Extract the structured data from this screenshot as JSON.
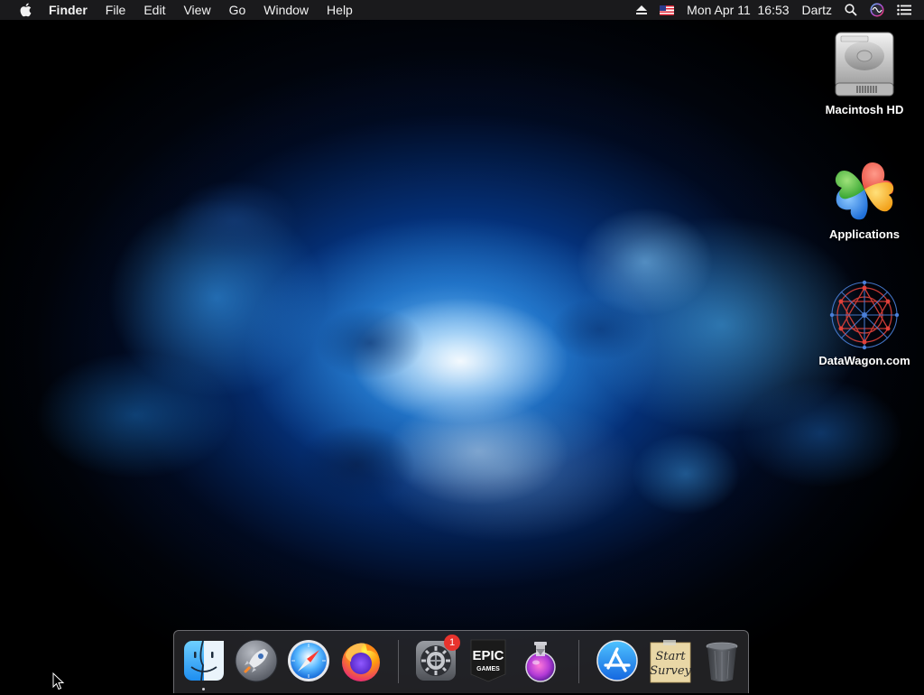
{
  "menubar": {
    "app_name": "Finder",
    "menus": [
      "File",
      "Edit",
      "View",
      "Go",
      "Window",
      "Help"
    ],
    "datetime": "Mon Apr 11  16:53",
    "user": "Dartz"
  },
  "desktop": {
    "icons": [
      {
        "label": "Macintosh HD",
        "icon": "hard-drive-icon"
      },
      {
        "label": "Applications",
        "icon": "applications-clover-icon"
      },
      {
        "label": "DataWagon.com",
        "icon": "datawagon-network-icon"
      }
    ]
  },
  "dock": {
    "items": [
      {
        "name": "Finder",
        "icon": "finder-icon",
        "running": true
      },
      {
        "name": "Launchpad",
        "icon": "rocket-icon"
      },
      {
        "name": "Safari",
        "icon": "compass-icon"
      },
      {
        "name": "Firefox",
        "icon": "firefox-icon"
      },
      {
        "name": "System Preferences",
        "icon": "gear-icon",
        "badge": "1"
      },
      {
        "name": "Epic Games",
        "icon": "epic-games-icon",
        "text_top": "EPIC",
        "text_bottom": "GAMES"
      },
      {
        "name": "Installer",
        "icon": "installer-flask-icon"
      },
      {
        "name": "App Store",
        "icon": "app-store-icon"
      },
      {
        "name": "Start Survey",
        "icon": "start-survey-note-icon",
        "note_line1": "Start",
        "note_line2": "Survey"
      },
      {
        "name": "Trash",
        "icon": "trash-icon"
      }
    ]
  },
  "colors": {
    "menubar_bg": "#1c1c1e",
    "badge_red": "#e8332d",
    "wallpaper_blue": "#1478e6"
  }
}
